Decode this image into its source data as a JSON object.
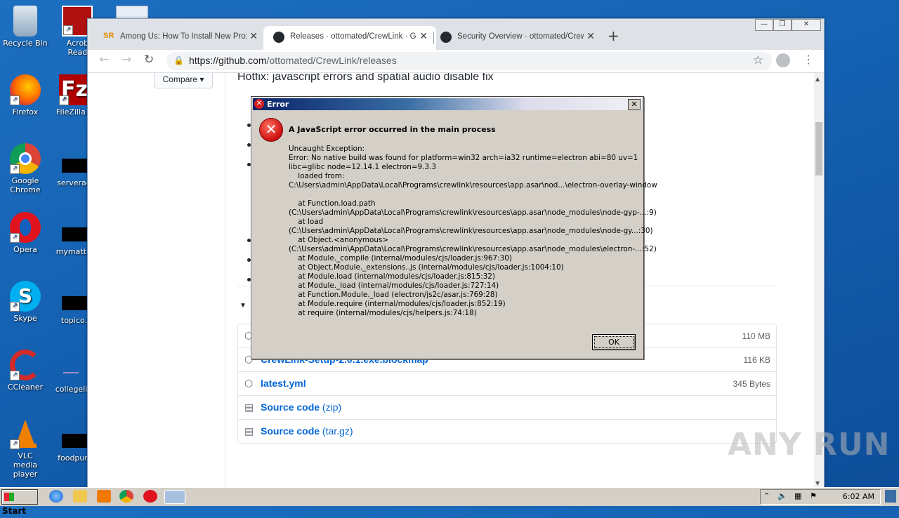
{
  "desktop": {
    "icons": [
      {
        "label": "Recycle Bin"
      },
      {
        "label": "Acrobat Reader"
      },
      {
        "label": "Firefox"
      },
      {
        "label": "FileZilla Cl"
      },
      {
        "label": "Google Chrome"
      },
      {
        "label": "serveradi"
      },
      {
        "label": "Opera"
      },
      {
        "label": "mymatter"
      },
      {
        "label": "Skype"
      },
      {
        "label": "topico.j"
      },
      {
        "label": "CCleaner"
      },
      {
        "label": "collegelite"
      },
      {
        "label": "VLC media player"
      },
      {
        "label": "foodpurp"
      }
    ]
  },
  "browser": {
    "tabs": [
      {
        "title": "Among Us: How To Install New Proxi",
        "favicon": "sr-icon"
      },
      {
        "title": "Releases · ottomated/CrewLink · Git",
        "favicon": "github-icon"
      },
      {
        "title": "Security Overview · ottomated/Crew",
        "favicon": "github-icon"
      }
    ],
    "url_host": "https://github.com",
    "url_path": "/ottomated/CrewLink/releases"
  },
  "page": {
    "compare_label": "Compare ▾",
    "release_heading": "Hotfix: javascript errors and spatial audio disable fix",
    "assets": [
      {
        "name": "",
        "size": "110 MB",
        "icon": "package-icon"
      },
      {
        "name": "CrewLink-Setup-2.0.1.exe.blockmap",
        "size": "116 KB",
        "icon": "package-icon"
      },
      {
        "name": "latest.yml",
        "size": "345 Bytes",
        "icon": "package-icon"
      },
      {
        "name": "Source code",
        "sub": "(zip)",
        "size": "",
        "icon": "file-zip-icon"
      },
      {
        "name": "Source code",
        "sub": "(tar.gz)",
        "size": "",
        "icon": "file-zip-icon"
      }
    ]
  },
  "dialog": {
    "title": "Error",
    "heading": "A JavaScript error occurred in the main process",
    "body": "Uncaught Exception:\nError: No native build was found for platform=win32 arch=ia32 runtime=electron abi=80 uv=1\nlibc=glibc node=12.14.1 electron=9.3.3\n    loaded from:\nC:\\Users\\admin\\AppData\\Local\\Programs\\crewlink\\resources\\app.asar\\nod...\\electron-overlay-window\n\n    at Function.load.path\n(C:\\Users\\admin\\AppData\\Local\\Programs\\crewlink\\resources\\app.asar\\node_modules\\node-gyp-...:9)\n    at load\n(C:\\Users\\admin\\AppData\\Local\\Programs\\crewlink\\resources\\app.asar\\node_modules\\node-gy...:30)\n    at Object.<anonymous>\n(C:\\Users\\admin\\AppData\\Local\\Programs\\crewlink\\resources\\app.asar\\node_modules\\electron-...:52)\n    at Module._compile (internal/modules/cjs/loader.js:967:30)\n    at Object.Module._extensions..js (internal/modules/cjs/loader.js:1004:10)\n    at Module.load (internal/modules/cjs/loader.js:815:32)\n    at Module._load (internal/modules/cjs/loader.js:727:14)\n    at Function.Module._load (electron/js2c/asar.js:769:28)\n    at Module.require (internal/modules/cjs/loader.js:852:19)\n    at require (internal/modules/cjs/helpers.js:74:18)",
    "ok_label": "OK"
  },
  "taskbar": {
    "start_label": "Start",
    "clock": "6:02 AM"
  },
  "watermark": "ANY RUN"
}
